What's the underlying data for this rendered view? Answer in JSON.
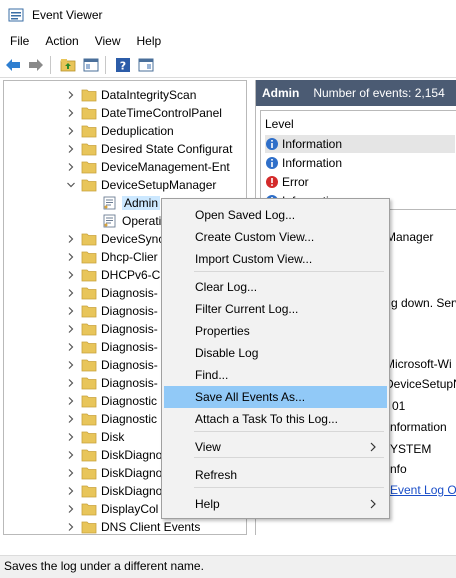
{
  "window": {
    "title": "Event Viewer"
  },
  "menubar": {
    "items": [
      "File",
      "Action",
      "View",
      "Help"
    ]
  },
  "tree": {
    "items": [
      {
        "label": "DataIntegrityScan",
        "expanded": false,
        "kind": "folder"
      },
      {
        "label": "DateTimeControlPanel",
        "expanded": false,
        "kind": "folder"
      },
      {
        "label": "Deduplication",
        "expanded": false,
        "kind": "folder"
      },
      {
        "label": "Desired State Configurat",
        "expanded": false,
        "kind": "folder"
      },
      {
        "label": "DeviceManagement-Ent",
        "expanded": false,
        "kind": "folder"
      },
      {
        "label": "DeviceSetupManager",
        "expanded": true,
        "kind": "folder"
      },
      {
        "label": "Admin",
        "kind": "log",
        "selected": true
      },
      {
        "label": "Operati",
        "kind": "log"
      },
      {
        "label": "DeviceSync",
        "expanded": false,
        "kind": "folder"
      },
      {
        "label": "Dhcp-Clier",
        "expanded": false,
        "kind": "folder"
      },
      {
        "label": "DHCPv6-C",
        "expanded": false,
        "kind": "folder"
      },
      {
        "label": "Diagnosis-",
        "expanded": false,
        "kind": "folder"
      },
      {
        "label": "Diagnosis-",
        "expanded": false,
        "kind": "folder"
      },
      {
        "label": "Diagnosis-",
        "expanded": false,
        "kind": "folder"
      },
      {
        "label": "Diagnosis-",
        "expanded": false,
        "kind": "folder"
      },
      {
        "label": "Diagnosis-",
        "expanded": false,
        "kind": "folder"
      },
      {
        "label": "Diagnosis-",
        "expanded": false,
        "kind": "folder"
      },
      {
        "label": "Diagnostic",
        "expanded": false,
        "kind": "folder"
      },
      {
        "label": "Diagnostic",
        "expanded": false,
        "kind": "folder"
      },
      {
        "label": "Disk",
        "expanded": false,
        "kind": "folder"
      },
      {
        "label": "DiskDiagno",
        "expanded": false,
        "kind": "folder"
      },
      {
        "label": "DiskDiagno",
        "expanded": false,
        "kind": "folder"
      },
      {
        "label": "DiskDiagno",
        "expanded": false,
        "kind": "folder"
      },
      {
        "label": "DisplayCol",
        "expanded": false,
        "kind": "folder"
      },
      {
        "label": "DNS Client Events",
        "expanded": false,
        "kind": "folder"
      }
    ]
  },
  "right": {
    "header_title": "Admin",
    "header_count": "Number of events: 2,154",
    "column_level": "Level",
    "events": [
      {
        "level": "Information",
        "type": "info"
      },
      {
        "level": "Information",
        "type": "info"
      },
      {
        "level": "Error",
        "type": "error"
      },
      {
        "level": "Informatio",
        "type": "info"
      }
    ],
    "detail_manager": "Manager",
    "detail_shutdown": "g down. Serv",
    "detail_source": "Microsoft-Wi",
    "detail_log": "DeviceSetupN",
    "detail_id": "01",
    "detail_info": "nformation",
    "detail_system": "YSTEM",
    "detail_nfo": "nfo",
    "detail_link": "Event Log Or"
  },
  "context_menu": {
    "items": [
      {
        "label": "Open Saved Log..."
      },
      {
        "label": "Create Custom View..."
      },
      {
        "label": "Import Custom View..."
      },
      {
        "label": "Clear Log..."
      },
      {
        "label": "Filter Current Log..."
      },
      {
        "label": "Properties"
      },
      {
        "label": "Disable Log"
      },
      {
        "label": "Find..."
      },
      {
        "label": "Save All Events As...",
        "hover": true
      },
      {
        "label": "Attach a Task To this Log..."
      },
      {
        "label": "View",
        "submenu": true
      },
      {
        "label": "Refresh"
      },
      {
        "label": "Help",
        "submenu": true
      }
    ]
  },
  "status_bar": {
    "text": "Saves the log under a different name."
  },
  "colors": {
    "header_bg": "#4b5b73",
    "menu_hover": "#91c9f7",
    "selected_bg": "#cce8ff",
    "folder_yellow": "#e8c55a",
    "link_blue": "#1a4ec8"
  }
}
